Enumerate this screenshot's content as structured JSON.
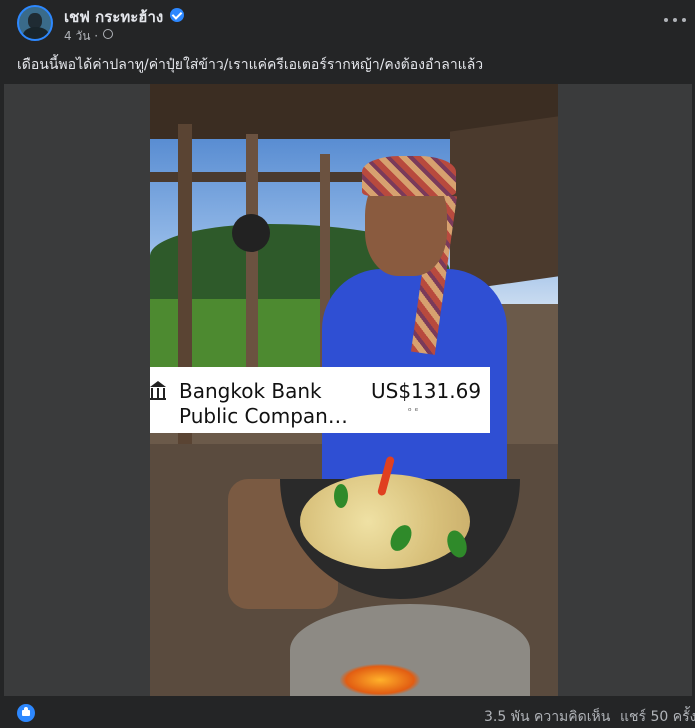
{
  "post": {
    "author_name": "เชฟ กระทะฮ้าง",
    "time": "4 วัน ·",
    "caption": "เดือนนี้พอได้ค่าปลาทู/ค่าปุ๋ยใส่ข้าว/เราแค่ครีเอเตอร์รากหญ้า/คงต้องอำลาแล้ว",
    "icons": {
      "verified": "verified-badge-icon",
      "audience": "globe-icon",
      "more": "more-options-icon",
      "like": "like-reaction-icon",
      "bank": "bank-icon"
    }
  },
  "overlay": {
    "name_line1": "Bangkok Bank",
    "name_line2": "Public Compan…",
    "price": "US$131.69",
    "sub": "ᵒ  ᵉ"
  },
  "footer": {
    "comments": "3.5 พัน ความคิดเห็น",
    "shares": "แชร์ 50 ครั้ง"
  },
  "colors": {
    "background": "#242526",
    "accent": "#2d88ff",
    "text_primary": "#e4e6eb",
    "text_secondary": "#b0b3b8"
  }
}
